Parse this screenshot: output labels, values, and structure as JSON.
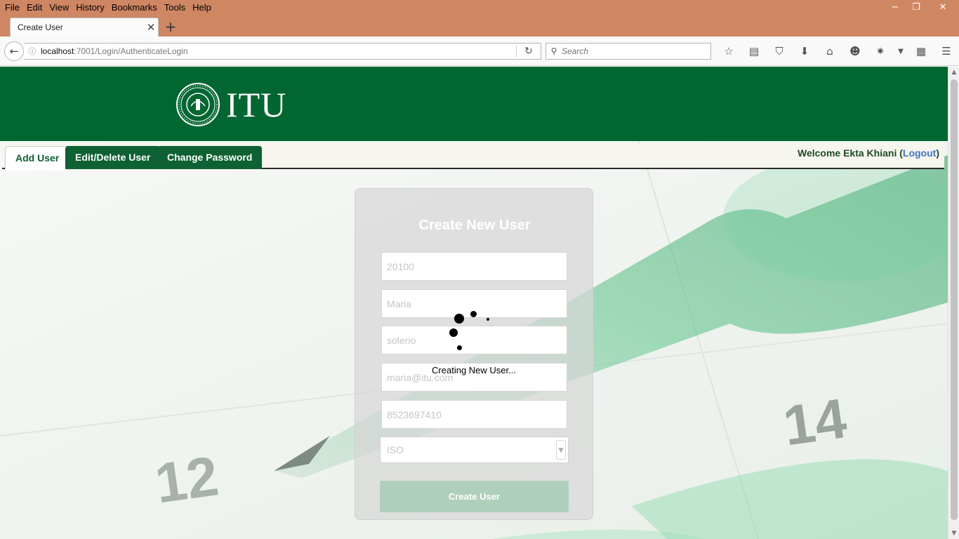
{
  "browser": {
    "menu": [
      "File",
      "Edit",
      "View",
      "History",
      "Bookmarks",
      "Tools",
      "Help"
    ],
    "window_controls": {
      "minimize": "−",
      "restore": "❐",
      "close": "✕"
    },
    "tab_title": "Create User",
    "tab_close": "✕",
    "new_tab": "+",
    "url_host": "localhost",
    "url_path": ":7001/Login/AuthenticateLogin",
    "search_placeholder": "Search"
  },
  "site": {
    "logo_text": "ITU",
    "tabs": [
      "Add User",
      "Edit/Delete User",
      "Change Password"
    ],
    "welcome_prefix": "Welcome Ekta Khiani (",
    "logout": "Logout",
    "welcome_suffix": ")"
  },
  "form": {
    "title": "Create New User",
    "fields": {
      "user_id": "20100",
      "first_name": "Maria",
      "last_name": "solerio",
      "email": "maria@itu.com",
      "phone": "8523697410"
    },
    "department": "ISO",
    "submit": "Create User"
  },
  "loading": {
    "text": "Creating New User..."
  },
  "colors": {
    "header_green": "#016630",
    "tab_green": "#0d6132",
    "browser_frame": "#cf8663",
    "button_disabled": "#aecfbc"
  }
}
